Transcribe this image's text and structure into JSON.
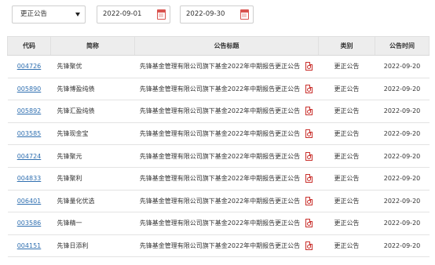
{
  "filters": {
    "type_select": {
      "value": "更正公告"
    },
    "start_date": {
      "value": "2022-09-01"
    },
    "end_date": {
      "value": "2022-09-30"
    }
  },
  "table": {
    "headers": {
      "code": "代码",
      "name": "简称",
      "title": "公告标题",
      "category": "类别",
      "time": "公告时间"
    },
    "rows": [
      {
        "code": "004726",
        "name": "先锋聚优",
        "title": "先锋基金管理有限公司旗下基金2022年中期报告更正公告",
        "category": "更正公告",
        "time": "2022-09-20"
      },
      {
        "code": "005890",
        "name": "先锋博盈纯债",
        "title": "先锋基金管理有限公司旗下基金2022年中期报告更正公告",
        "category": "更正公告",
        "time": "2022-09-20"
      },
      {
        "code": "005892",
        "name": "先锋汇盈纯债",
        "title": "先锋基金管理有限公司旗下基金2022年中期报告更正公告",
        "category": "更正公告",
        "time": "2022-09-20"
      },
      {
        "code": "003585",
        "name": "先锋现金宝",
        "title": "先锋基金管理有限公司旗下基金2022年中期报告更正公告",
        "category": "更正公告",
        "time": "2022-09-20"
      },
      {
        "code": "004724",
        "name": "先锋聚元",
        "title": "先锋基金管理有限公司旗下基金2022年中期报告更正公告",
        "category": "更正公告",
        "time": "2022-09-20"
      },
      {
        "code": "004833",
        "name": "先锋聚利",
        "title": "先锋基金管理有限公司旗下基金2022年中期报告更正公告",
        "category": "更正公告",
        "time": "2022-09-20"
      },
      {
        "code": "006401",
        "name": "先锋量化优选",
        "title": "先锋基金管理有限公司旗下基金2022年中期报告更正公告",
        "category": "更正公告",
        "time": "2022-09-20"
      },
      {
        "code": "003586",
        "name": "先锋精一",
        "title": "先锋基金管理有限公司旗下基金2022年中期报告更正公告",
        "category": "更正公告",
        "time": "2022-09-20"
      },
      {
        "code": "004151",
        "name": "先锋日添利",
        "title": "先锋基金管理有限公司旗下基金2022年中期报告更正公告",
        "category": "更正公告",
        "time": "2022-09-20"
      }
    ]
  },
  "icons": {
    "date_picker": "calendar-icon",
    "row_attachment": "pdf-icon"
  },
  "colors": {
    "link": "#2f6fb0",
    "icon_red": "#d9534f",
    "header_bg": "#ededed"
  }
}
